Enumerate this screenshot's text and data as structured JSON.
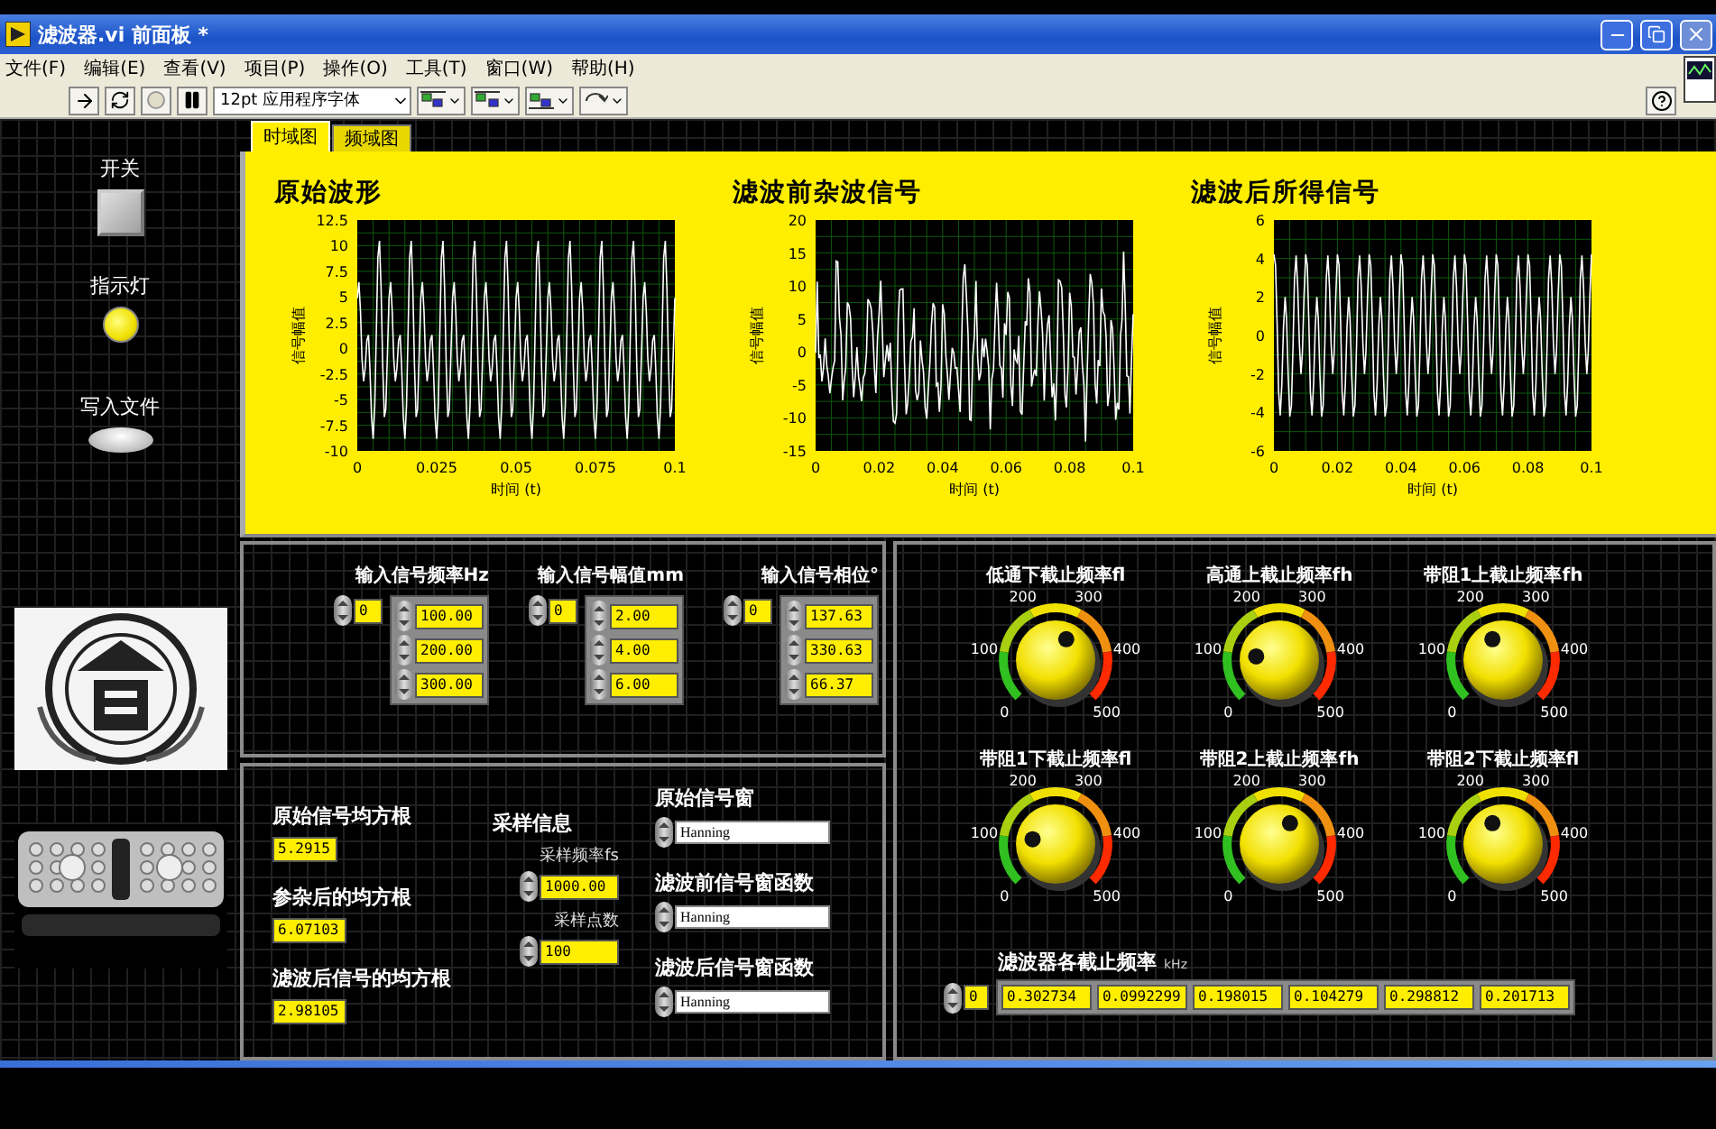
{
  "window": {
    "title": "滤波器.vi 前面板 *"
  },
  "menu": [
    "文件(F)",
    "编辑(E)",
    "查看(V)",
    "项目(P)",
    "操作(O)",
    "工具(T)",
    "窗口(W)",
    "帮助(H)"
  ],
  "toolbar": {
    "font": "12pt 应用程序字体"
  },
  "left_panel": {
    "switch_label": "开关",
    "indicator": {
      "label": "指示灯",
      "on": true
    },
    "write_label": "写入文件"
  },
  "tabs": [
    {
      "label": "时域图",
      "selected": true
    },
    {
      "label": "频域图",
      "selected": false
    }
  ],
  "charts": [
    {
      "title": "原始波形",
      "ylabel": "信号幅值",
      "xlabel": "时间 (t)",
      "yticks": [
        "12.5",
        "10",
        "7.5",
        "5",
        "2.5",
        "0",
        "-2.5",
        "-5",
        "-7.5",
        "-10"
      ],
      "xticks": [
        "0",
        "0.025",
        "0.05",
        "0.075",
        "0.1"
      ]
    },
    {
      "title": "滤波前杂波信号",
      "ylabel": "信号幅值",
      "xlabel": "时间 (t)",
      "yticks": [
        "20",
        "15",
        "10",
        "5",
        "0",
        "-5",
        "-10",
        "-15"
      ],
      "xticks": [
        "0",
        "0.02",
        "0.04",
        "0.06",
        "0.08",
        "0.1"
      ]
    },
    {
      "title": "滤波后所得信号",
      "ylabel": "信号幅值",
      "xlabel": "时间 (t)",
      "yticks": [
        "6",
        "4",
        "2",
        "0",
        "-2",
        "-4",
        "-6"
      ],
      "xticks": [
        "0",
        "0.02",
        "0.04",
        "0.06",
        "0.08",
        "0.1"
      ]
    }
  ],
  "inputs": [
    {
      "label": "输入信号频率Hz",
      "index": "0",
      "values": [
        "100.00",
        "200.00",
        "300.00"
      ]
    },
    {
      "label": "输入信号幅值mm",
      "index": "0",
      "values": [
        "2.00",
        "4.00",
        "6.00"
      ]
    },
    {
      "label": "输入信号相位°",
      "index": "0",
      "values": [
        "137.63",
        "330.63",
        "66.37"
      ]
    }
  ],
  "rms": [
    {
      "label": "原始信号均方根",
      "value": "5.2915"
    },
    {
      "label": "参杂后的均方根",
      "value": "6.07103"
    },
    {
      "label": "滤波后信号的均方根",
      "value": "2.98105"
    }
  ],
  "sampling": {
    "title": "采样信息",
    "fields": [
      {
        "label": "采样频率fs",
        "value": "1000.00"
      },
      {
        "label": "采样点数",
        "value": "100"
      }
    ]
  },
  "windows": [
    {
      "label": "原始信号窗",
      "value": "Hanning"
    },
    {
      "label": "滤波前信号窗函数",
      "value": "Hanning"
    },
    {
      "label": "滤波后信号窗函数",
      "value": "Hanning"
    }
  ],
  "knobs": [
    {
      "label": "低通下截止频率fl",
      "level": 0.6,
      "scale": [
        "0",
        "100",
        "200",
        "300",
        "400",
        "500"
      ]
    },
    {
      "label": "高通上截止频率fh",
      "level": 0.2,
      "scale": [
        "0",
        "100",
        "200",
        "300",
        "400",
        "500"
      ]
    },
    {
      "label": "带阻1上截止频率fh",
      "level": 0.4,
      "scale": [
        "0",
        "100",
        "200",
        "300",
        "400",
        "500"
      ]
    },
    {
      "label": "带阻1下截止频率fl",
      "level": 0.21,
      "scale": [
        "0",
        "100",
        "200",
        "300",
        "400",
        "500"
      ]
    },
    {
      "label": "带阻2上截止频率fh",
      "level": 0.6,
      "scale": [
        "0",
        "100",
        "200",
        "300",
        "400",
        "500"
      ]
    },
    {
      "label": "带阻2下截止频率fl",
      "level": 0.4,
      "scale": [
        "0",
        "100",
        "200",
        "300",
        "400",
        "500"
      ]
    }
  ],
  "cutoffs": {
    "label": "滤波器各截止频率",
    "unit": "kHz",
    "index": "0",
    "values": [
      "0.302734",
      "0.0992299",
      "0.198015",
      "0.104279",
      "0.298812",
      "0.201713"
    ]
  }
}
